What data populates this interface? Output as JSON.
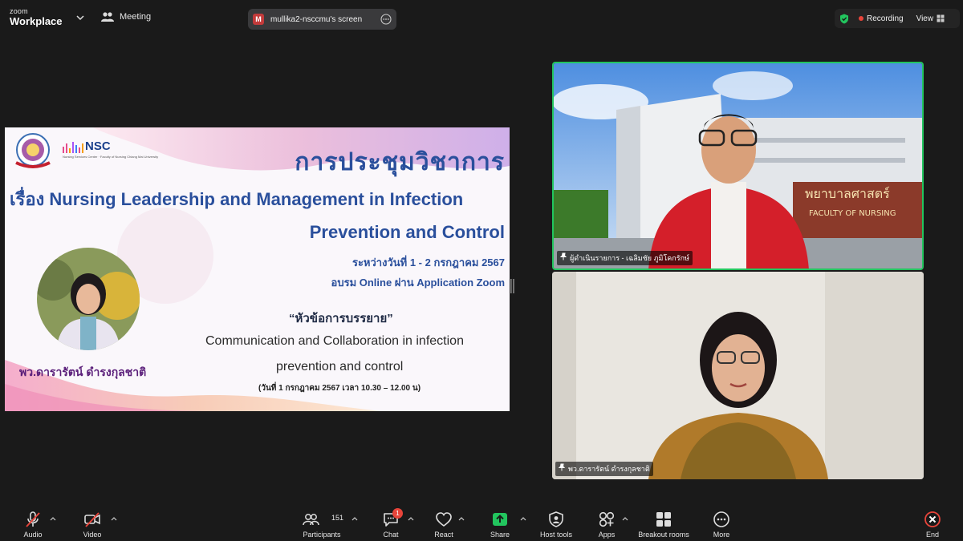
{
  "topbar": {
    "brand_line1": "zoom",
    "brand_line2": "Workplace",
    "meeting_label": "Meeting",
    "share_initial": "M",
    "share_label": "mullika2-nsccmu's screen",
    "recording_label": "Recording",
    "view_label": "View"
  },
  "slide": {
    "logo_text": "NSC",
    "logo_subtext": "Nursing Services Center · Faculty of Nursing Chiang Mai University",
    "heading": "การประชุมวิชาการ",
    "subject_line1": "เรื่อง Nursing Leadership and Management in Infection",
    "subject_line2": "Prevention and Control",
    "date_line": "ระหว่างวันที่ 1 - 2 กรกฎาคม 2567",
    "online_line": "อบรม Online ผ่าน Application Zoom",
    "topic_title": "“หัวข้อการบรรยาย”",
    "topic_line1": "Communication and Collaboration in infection",
    "topic_line2": "prevention and control",
    "time_line": "(วันที่ 1 กรกฎาคม 2567 เวลา 10.30 – 12.00 น)",
    "speaker_name": "พว.ดารารัตน์ ดำรงกุลชาติ"
  },
  "tiles": [
    {
      "name": "ผู้ดำเนินรายการ - เฉลิมชัย ภูมิโคกรักษ์",
      "building_sign": "พยาบาลศาสตร์",
      "building_sign_en": "FACULTY OF NURSING"
    },
    {
      "name": "พว.ดารารัตน์ ดำรงกุลชาติ"
    }
  ],
  "toolbar": {
    "audio": "Audio",
    "video": "Video",
    "participants": "Participants",
    "participants_count": "151",
    "chat": "Chat",
    "chat_badge": "1",
    "react": "React",
    "share": "Share",
    "host_tools": "Host tools",
    "apps": "Apps",
    "breakout_rooms": "Breakout rooms",
    "more": "More",
    "end": "End"
  },
  "colors": {
    "active_speaker_border": "#22c55e",
    "share_accent": "#22c55e",
    "end_red": "#e8443a",
    "slide_blue": "#2a4f9c",
    "slide_purple": "#5a1e7a"
  }
}
